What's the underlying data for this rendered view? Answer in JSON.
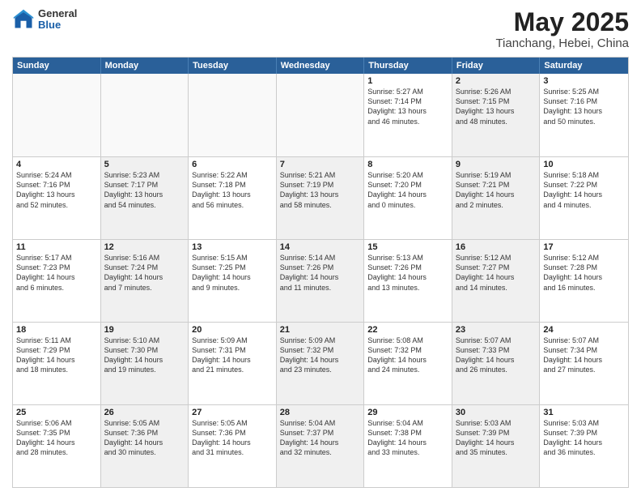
{
  "header": {
    "logo": {
      "line1": "General",
      "line2": "Blue"
    },
    "title": "May 2025",
    "subtitle": "Tianchang, Hebei, China"
  },
  "weekdays": [
    "Sunday",
    "Monday",
    "Tuesday",
    "Wednesday",
    "Thursday",
    "Friday",
    "Saturday"
  ],
  "weeks": [
    [
      {
        "day": "",
        "text": "",
        "empty": true
      },
      {
        "day": "",
        "text": "",
        "empty": true
      },
      {
        "day": "",
        "text": "",
        "empty": true
      },
      {
        "day": "",
        "text": "",
        "empty": true
      },
      {
        "day": "1",
        "text": "Sunrise: 5:27 AM\nSunset: 7:14 PM\nDaylight: 13 hours\nand 46 minutes.",
        "empty": false,
        "shaded": false
      },
      {
        "day": "2",
        "text": "Sunrise: 5:26 AM\nSunset: 7:15 PM\nDaylight: 13 hours\nand 48 minutes.",
        "empty": false,
        "shaded": true
      },
      {
        "day": "3",
        "text": "Sunrise: 5:25 AM\nSunset: 7:16 PM\nDaylight: 13 hours\nand 50 minutes.",
        "empty": false,
        "shaded": false
      }
    ],
    [
      {
        "day": "4",
        "text": "Sunrise: 5:24 AM\nSunset: 7:16 PM\nDaylight: 13 hours\nand 52 minutes.",
        "empty": false,
        "shaded": false
      },
      {
        "day": "5",
        "text": "Sunrise: 5:23 AM\nSunset: 7:17 PM\nDaylight: 13 hours\nand 54 minutes.",
        "empty": false,
        "shaded": true
      },
      {
        "day": "6",
        "text": "Sunrise: 5:22 AM\nSunset: 7:18 PM\nDaylight: 13 hours\nand 56 minutes.",
        "empty": false,
        "shaded": false
      },
      {
        "day": "7",
        "text": "Sunrise: 5:21 AM\nSunset: 7:19 PM\nDaylight: 13 hours\nand 58 minutes.",
        "empty": false,
        "shaded": true
      },
      {
        "day": "8",
        "text": "Sunrise: 5:20 AM\nSunset: 7:20 PM\nDaylight: 14 hours\nand 0 minutes.",
        "empty": false,
        "shaded": false
      },
      {
        "day": "9",
        "text": "Sunrise: 5:19 AM\nSunset: 7:21 PM\nDaylight: 14 hours\nand 2 minutes.",
        "empty": false,
        "shaded": true
      },
      {
        "day": "10",
        "text": "Sunrise: 5:18 AM\nSunset: 7:22 PM\nDaylight: 14 hours\nand 4 minutes.",
        "empty": false,
        "shaded": false
      }
    ],
    [
      {
        "day": "11",
        "text": "Sunrise: 5:17 AM\nSunset: 7:23 PM\nDaylight: 14 hours\nand 6 minutes.",
        "empty": false,
        "shaded": false
      },
      {
        "day": "12",
        "text": "Sunrise: 5:16 AM\nSunset: 7:24 PM\nDaylight: 14 hours\nand 7 minutes.",
        "empty": false,
        "shaded": true
      },
      {
        "day": "13",
        "text": "Sunrise: 5:15 AM\nSunset: 7:25 PM\nDaylight: 14 hours\nand 9 minutes.",
        "empty": false,
        "shaded": false
      },
      {
        "day": "14",
        "text": "Sunrise: 5:14 AM\nSunset: 7:26 PM\nDaylight: 14 hours\nand 11 minutes.",
        "empty": false,
        "shaded": true
      },
      {
        "day": "15",
        "text": "Sunrise: 5:13 AM\nSunset: 7:26 PM\nDaylight: 14 hours\nand 13 minutes.",
        "empty": false,
        "shaded": false
      },
      {
        "day": "16",
        "text": "Sunrise: 5:12 AM\nSunset: 7:27 PM\nDaylight: 14 hours\nand 14 minutes.",
        "empty": false,
        "shaded": true
      },
      {
        "day": "17",
        "text": "Sunrise: 5:12 AM\nSunset: 7:28 PM\nDaylight: 14 hours\nand 16 minutes.",
        "empty": false,
        "shaded": false
      }
    ],
    [
      {
        "day": "18",
        "text": "Sunrise: 5:11 AM\nSunset: 7:29 PM\nDaylight: 14 hours\nand 18 minutes.",
        "empty": false,
        "shaded": false
      },
      {
        "day": "19",
        "text": "Sunrise: 5:10 AM\nSunset: 7:30 PM\nDaylight: 14 hours\nand 19 minutes.",
        "empty": false,
        "shaded": true
      },
      {
        "day": "20",
        "text": "Sunrise: 5:09 AM\nSunset: 7:31 PM\nDaylight: 14 hours\nand 21 minutes.",
        "empty": false,
        "shaded": false
      },
      {
        "day": "21",
        "text": "Sunrise: 5:09 AM\nSunset: 7:32 PM\nDaylight: 14 hours\nand 23 minutes.",
        "empty": false,
        "shaded": true
      },
      {
        "day": "22",
        "text": "Sunrise: 5:08 AM\nSunset: 7:32 PM\nDaylight: 14 hours\nand 24 minutes.",
        "empty": false,
        "shaded": false
      },
      {
        "day": "23",
        "text": "Sunrise: 5:07 AM\nSunset: 7:33 PM\nDaylight: 14 hours\nand 26 minutes.",
        "empty": false,
        "shaded": true
      },
      {
        "day": "24",
        "text": "Sunrise: 5:07 AM\nSunset: 7:34 PM\nDaylight: 14 hours\nand 27 minutes.",
        "empty": false,
        "shaded": false
      }
    ],
    [
      {
        "day": "25",
        "text": "Sunrise: 5:06 AM\nSunset: 7:35 PM\nDaylight: 14 hours\nand 28 minutes.",
        "empty": false,
        "shaded": false
      },
      {
        "day": "26",
        "text": "Sunrise: 5:05 AM\nSunset: 7:36 PM\nDaylight: 14 hours\nand 30 minutes.",
        "empty": false,
        "shaded": true
      },
      {
        "day": "27",
        "text": "Sunrise: 5:05 AM\nSunset: 7:36 PM\nDaylight: 14 hours\nand 31 minutes.",
        "empty": false,
        "shaded": false
      },
      {
        "day": "28",
        "text": "Sunrise: 5:04 AM\nSunset: 7:37 PM\nDaylight: 14 hours\nand 32 minutes.",
        "empty": false,
        "shaded": true
      },
      {
        "day": "29",
        "text": "Sunrise: 5:04 AM\nSunset: 7:38 PM\nDaylight: 14 hours\nand 33 minutes.",
        "empty": false,
        "shaded": false
      },
      {
        "day": "30",
        "text": "Sunrise: 5:03 AM\nSunset: 7:39 PM\nDaylight: 14 hours\nand 35 minutes.",
        "empty": false,
        "shaded": true
      },
      {
        "day": "31",
        "text": "Sunrise: 5:03 AM\nSunset: 7:39 PM\nDaylight: 14 hours\nand 36 minutes.",
        "empty": false,
        "shaded": false
      }
    ]
  ]
}
